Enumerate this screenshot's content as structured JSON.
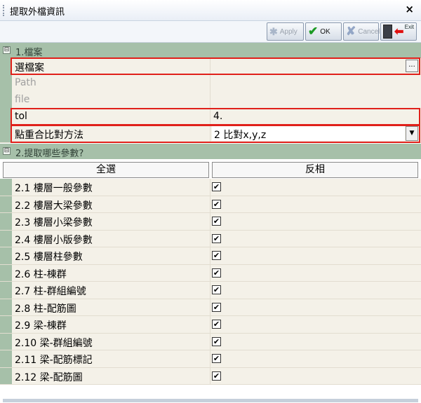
{
  "window": {
    "title": "提取外檔資訊",
    "close_glyph": "×"
  },
  "toolbar": {
    "apply_label": "Apply",
    "ok_label": "OK",
    "cancel_label": "Cancel",
    "exit_label": "Exit"
  },
  "section1": {
    "label": "1.檔案",
    "expander": "⊟"
  },
  "props": {
    "select_file": {
      "name": "選檔案",
      "button": "..."
    },
    "path": {
      "name": "Path",
      "value": ""
    },
    "file": {
      "name": "file",
      "value": ""
    },
    "tol": {
      "name": "tol",
      "value": "4."
    },
    "method": {
      "name": "點重合比對方法",
      "value": "2 比對x,y,z",
      "dropdown_glyph": "▼"
    }
  },
  "section2": {
    "label": "2.提取哪些參數?",
    "expander": "⊟"
  },
  "list_header": {
    "select_all": "全選",
    "invert": "反相"
  },
  "items": [
    {
      "label": "2.1 樓層一般參數",
      "checked": true,
      "mark": "✔"
    },
    {
      "label": "2.2 樓層大梁參數",
      "checked": true,
      "mark": "✔"
    },
    {
      "label": "2.3 樓層小梁參數",
      "checked": true,
      "mark": "✔"
    },
    {
      "label": "2.4 樓層小版參數",
      "checked": true,
      "mark": "✔"
    },
    {
      "label": "2.5 樓層柱參數",
      "checked": true,
      "mark": "✔"
    },
    {
      "label": "2.6 柱-棟群",
      "checked": true,
      "mark": "✔"
    },
    {
      "label": "2.7 柱-群組編號",
      "checked": true,
      "mark": "✔"
    },
    {
      "label": "2.8 柱-配筋圖",
      "checked": true,
      "mark": "✔"
    },
    {
      "label": "2.9 梁-棟群",
      "checked": true,
      "mark": "✔"
    },
    {
      "label": "2.10 梁-群組編號",
      "checked": true,
      "mark": "✔"
    },
    {
      "label": "2.11 梁-配筋標記",
      "checked": true,
      "mark": "✔"
    },
    {
      "label": "2.12 梁-配筋圖",
      "checked": true,
      "mark": "✔"
    }
  ],
  "colors": {
    "section_bg": "#a6c0a9",
    "row_bg": "#f4f1e8",
    "highlight": "#e0201a",
    "ok_check": "#1c9a24"
  }
}
